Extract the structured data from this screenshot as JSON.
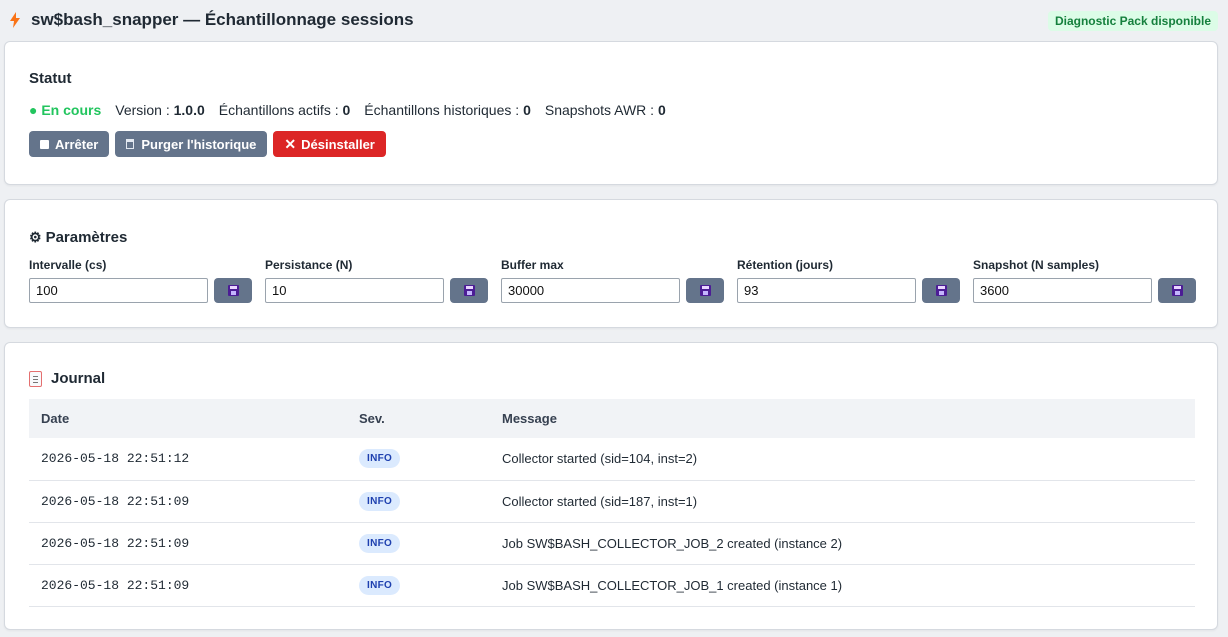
{
  "header": {
    "title": "sw$bash_snapper — Échantillonnage sessions",
    "badge": "Diagnostic Pack disponible"
  },
  "status": {
    "heading": "Statut",
    "state": "● En cours",
    "version_label": "Version : ",
    "version": "1.0.0",
    "active_label": "Échantillons actifs : ",
    "active": "0",
    "historic_label": "Échantillons historiques : ",
    "historic": "0",
    "awr_label": "Snapshots AWR : ",
    "awr": "0",
    "buttons": {
      "stop": "Arrêter",
      "purge": "Purger l'historique",
      "uninstall": "Désinstaller"
    }
  },
  "params": {
    "heading": "Paramètres",
    "fields": [
      {
        "label": "Intervalle (cs)",
        "value": "100"
      },
      {
        "label": "Persistance (N)",
        "value": "10"
      },
      {
        "label": "Buffer max",
        "value": "30000"
      },
      {
        "label": "Rétention (jours)",
        "value": "93"
      },
      {
        "label": "Snapshot (N samples)",
        "value": "3600"
      }
    ]
  },
  "journal": {
    "heading": "Journal",
    "columns": [
      "Date",
      "Sev.",
      "Message"
    ],
    "rows": [
      {
        "date": "2026-05-18 22:51:12",
        "sev": "INFO",
        "message": "Collector started (sid=104, inst=2)"
      },
      {
        "date": "2026-05-18 22:51:09",
        "sev": "INFO",
        "message": "Collector started (sid=187, inst=1)"
      },
      {
        "date": "2026-05-18 22:51:09",
        "sev": "INFO",
        "message": "Job SW$BASH_COLLECTOR_JOB_2 created (instance 2)"
      },
      {
        "date": "2026-05-18 22:51:09",
        "sev": "INFO",
        "message": "Job SW$BASH_COLLECTOR_JOB_1 created (instance 1)"
      }
    ]
  },
  "colors": {
    "running": "#22c55e",
    "danger": "#dc2626",
    "secondary": "#64748b",
    "badge_bg": "#dcfce7",
    "badge_fg": "#15803d"
  }
}
